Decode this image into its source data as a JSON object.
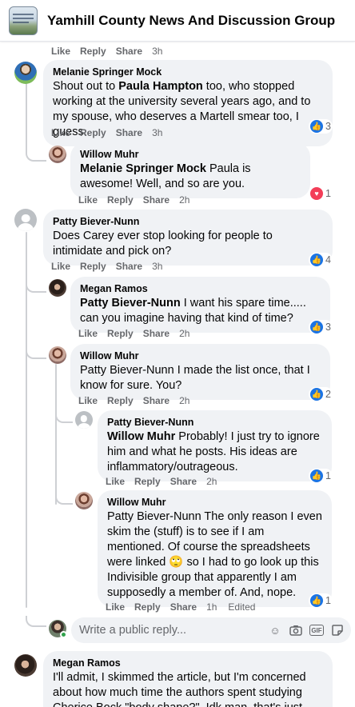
{
  "header": {
    "title": "Yamhill County News And Discussion Group"
  },
  "actions": {
    "like": "Like",
    "reply": "Reply",
    "share": "Share",
    "edited": "Edited"
  },
  "comments": [
    {
      "time": "3h"
    },
    {
      "author": "Melanie Springer Mock",
      "text": "Shout out to Paula Hampton too, who stopped working at the university several years ago, and to my spouse, who deserves a Martell smear too, I guess.",
      "mention": "Paula Hampton",
      "time": "3h",
      "reactions": "3"
    },
    {
      "author": "Willow Muhr",
      "mention": "Melanie Springer Mock",
      "text": "Paula is awesome! Well, and so are you.",
      "time": "2h",
      "reactions": "1"
    },
    {
      "author": "Patty Biever-Nunn",
      "text": "Does Carey ever stop looking for people to intimidate and pick on?",
      "time": "3h",
      "reactions": "4"
    },
    {
      "author": "Megan Ramos",
      "mention": "Patty Biever-Nunn",
      "text": "I want his spare time..... can you imagine having that kind of time?",
      "time": "2h",
      "reactions": "3"
    },
    {
      "author": "Willow Muhr",
      "text": "Patty Biever-Nunn I made the list once, that I know for sure. You?",
      "time": "2h",
      "reactions": "2"
    },
    {
      "author": "Patty Biever-Nunn",
      "mention": "Willow Muhr",
      "text": "Probably! I just try to ignore him and what he posts. His ideas are inflammatory/outrageous.",
      "time": "2h",
      "reactions": "1"
    },
    {
      "author": "Willow Muhr",
      "text": "Patty Biever-Nunn The only reason I even skim the (stuff) is to see if I am mentioned. Of course the spreadsheets were linked 🙄 so I had to go look up this Indivisible group that apparently I am supposedly a member of. And, nope.",
      "time": "1h",
      "reactions": "1"
    },
    {
      "author": "Megan Ramos",
      "text": "I'll admit, I skimmed the article, but I'm concerned about how much time the authors spent studying Cherice Bock \"body shape?\". Idk man, that's just creepy...."
    }
  ],
  "reply_box": {
    "placeholder": "Write a public reply..."
  },
  "icons": [
    "like-icon",
    "love-icon",
    "emoji-icon",
    "camera-icon",
    "gif-icon",
    "sticker-icon"
  ],
  "colors": {
    "like_blue": "#1b74e4",
    "love_red": "#f33e58",
    "bubble": "#f0f2f5",
    "secondary_text": "#65676b"
  }
}
